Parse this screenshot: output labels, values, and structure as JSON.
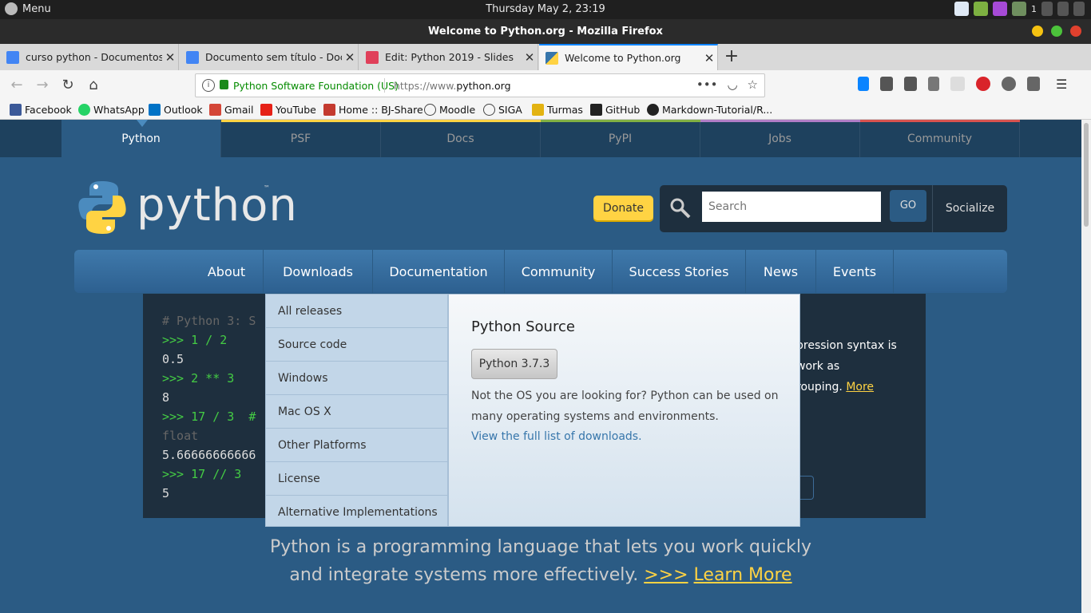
{
  "system": {
    "menu_label": "Menu",
    "clock": "Thursday May  2, 23:19",
    "notification_count": "1"
  },
  "window": {
    "title": "Welcome to Python.org - Mozilla Firefox"
  },
  "tabs": [
    {
      "label": "curso python - Documentos G",
      "favicon_color": "#4285f4"
    },
    {
      "label": "Documento sem título - Docu",
      "favicon_color": "#4285f4"
    },
    {
      "label": "Edit: Python 2019 - Slides",
      "favicon_color": "#e0405a"
    },
    {
      "label": "Welcome to Python.org",
      "favicon_color": "#ffd343"
    }
  ],
  "newtab_symbol": "+",
  "urlbar": {
    "org_name": "Python Software Foundation (US)",
    "url_prefix": "https://www.",
    "url_domain": "python.org",
    "more_symbol": "•••"
  },
  "bookmarks": [
    {
      "label": "Facebook",
      "color": "#3b5998"
    },
    {
      "label": "WhatsApp",
      "color": "#25d366"
    },
    {
      "label": "Outlook",
      "color": "#0072c6"
    },
    {
      "label": "Gmail",
      "color": "#d44638"
    },
    {
      "label": "YouTube",
      "color": "#e62117"
    },
    {
      "label": "Home :: BJ-Share",
      "color": "#c43a2f"
    },
    {
      "label": "Moodle",
      "color": "#444444"
    },
    {
      "label": "SIGA",
      "color": "#444444"
    },
    {
      "label": "Turmas",
      "color": "#e3b312"
    },
    {
      "label": "GitHub",
      "color": "#222222"
    },
    {
      "label": "Markdown-Tutorial/R...",
      "color": "#222222"
    }
  ],
  "meta_nav": {
    "items": [
      "Python",
      "PSF",
      "Docs",
      "PyPI",
      "Jobs",
      "Community"
    ],
    "bar_colors": [
      "#4b8bbe",
      "#ffd343",
      "#ffd343",
      "#82b043",
      "#b07dc6",
      "#d9534f"
    ]
  },
  "header": {
    "logo_text": "python",
    "logo_tm": "™",
    "donate_label": "Donate",
    "search_placeholder": "Search",
    "go_label": "GO",
    "socialize_label": "Socialize"
  },
  "main_nav": [
    "About",
    "Downloads",
    "Documentation",
    "Community",
    "Success Stories",
    "News",
    "Events"
  ],
  "shell": {
    "lines": [
      {
        "text": "# Python 3: S",
        "kind": "comment"
      },
      {
        "text": ">>> 1 / 2",
        "kind": "prompt"
      },
      {
        "text": "0.5",
        "kind": "output"
      },
      {
        "text": ">>> 2 ** 3",
        "kind": "prompt"
      },
      {
        "text": "8",
        "kind": "output"
      },
      {
        "text": ">>> 17 / 3  #",
        "kind": "prompt"
      },
      {
        "text": "float",
        "kind": "comment"
      },
      {
        "text": "5.66666666666",
        "kind": "output"
      },
      {
        "text": ">>> 17 // 3",
        "kind": "prompt"
      },
      {
        "text": "5",
        "kind": "output"
      }
    ],
    "intro_line1": "pression syntax is",
    "intro_line2": " work as",
    "intro_line3": "rouping. ",
    "intro_more": "More"
  },
  "downloads_menu": {
    "items": [
      "All releases",
      "Source code",
      "Windows",
      "Mac OS X",
      "Other Platforms",
      "License",
      "Alternative Implementations"
    ],
    "panel_title": "Python Source",
    "version_button": "Python 3.7.3",
    "description": "Not the OS you are looking for? Python can be used on many operating systems and environments.",
    "full_list_link": "View the full list of downloads."
  },
  "tagline": {
    "line1": "Python is a programming language that lets you work quickly",
    "line2": "and integrate systems more effectively. ",
    "arrows": ">>>",
    "learn_more": "Learn More"
  }
}
